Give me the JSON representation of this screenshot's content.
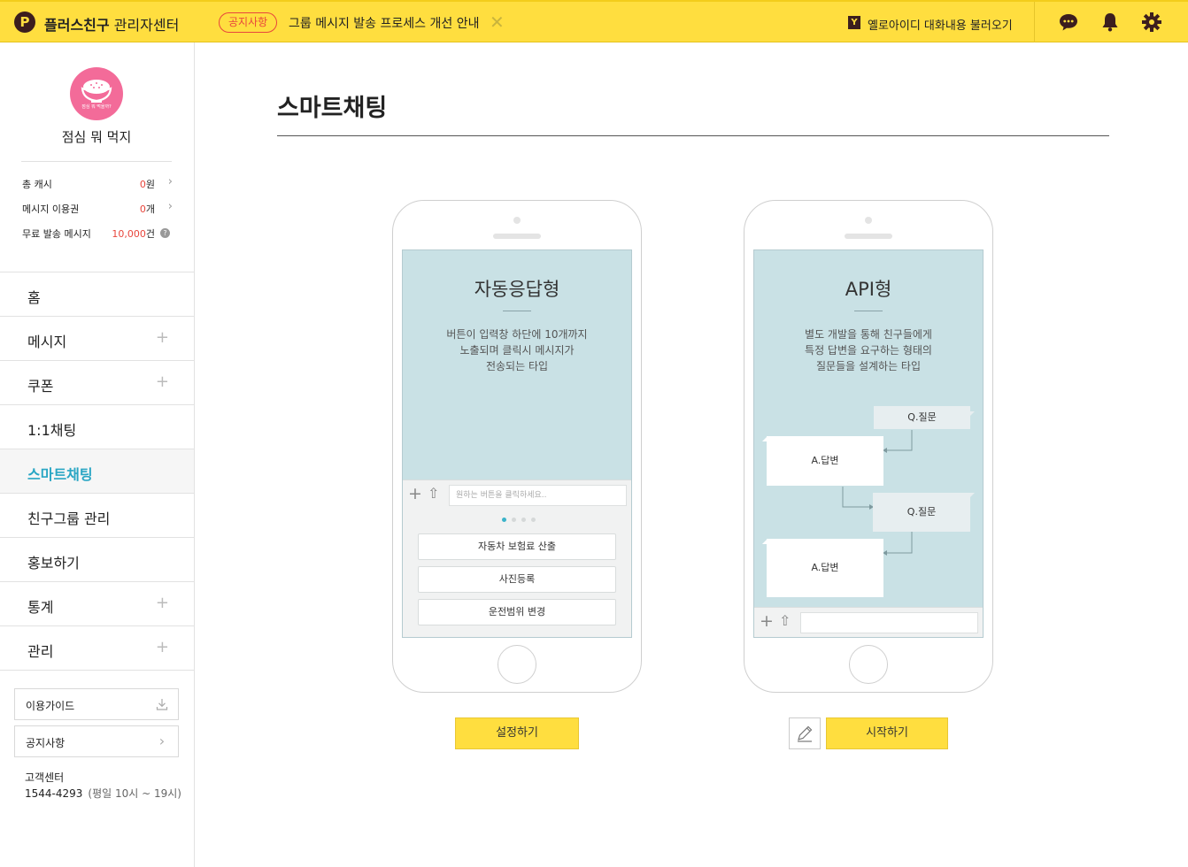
{
  "topbar": {
    "logo_glyph": "P",
    "brand_bold": "플러스친구",
    "brand_rest": " 관리자센터",
    "notice_tag": "공지사항",
    "notice_text": "그룹 메시지 발송 프로세스 개선 안내",
    "close_glyph": "✕",
    "yellowid_glyph": "Y",
    "yellowid_text": "옐로아이디 대화내용 불러오기",
    "icons": [
      "chat-bubble-icon",
      "bell-icon",
      "gear-icon"
    ]
  },
  "profile": {
    "name": "점심 뭐 먹지",
    "avatar_caption": "점심 뭐 먹을까?",
    "stats": [
      {
        "label": "총 캐시",
        "value": "0",
        "unit": "원"
      },
      {
        "label": "메시지 이용권",
        "value": "0",
        "unit": "개"
      },
      {
        "label": "무료 발송 메시지",
        "value": "10,000",
        "unit": "건"
      }
    ],
    "chevron": "›",
    "help_glyph": "?"
  },
  "nav": {
    "plus_glyph": "+",
    "items": [
      {
        "label": "홈"
      },
      {
        "label": "메시지"
      },
      {
        "label": "쿠폰"
      },
      {
        "label": "1:1채팅"
      },
      {
        "label": "스마트채팅"
      },
      {
        "label": "친구그룹 관리"
      },
      {
        "label": "홍보하기"
      },
      {
        "label": "통계"
      },
      {
        "label": "관리"
      }
    ]
  },
  "sidebar_buttons": {
    "guide": "이용가이드",
    "notice": "공지사항",
    "chevron": "›"
  },
  "customer_center": {
    "label": "고객센터",
    "phone": "1544-4293",
    "hours": "(평일 10시 ~ 19시)"
  },
  "main": {
    "title": "스마트채팅",
    "auto": {
      "title": "자동응답형",
      "desc": [
        "버튼이 입력창 하단에 10개까지",
        "노출되며 클릭시 메시지가",
        "전송되는 타입"
      ],
      "input_placeholder": "원하는 버튼을 클릭하세요..",
      "plus_glyph": "+",
      "up_glyph": "⇧",
      "buttons": [
        "자동차 보험료 산출",
        "사진등록",
        "운전범위 변경"
      ],
      "action": "설정하기"
    },
    "api": {
      "title": "API형",
      "desc": [
        "별도 개발을 통해 친구들에게",
        "특정 답변을 요구하는 형태의",
        "질문들을 설계하는 타입"
      ],
      "question": "Q.질문",
      "answer": "A.답변",
      "plus_glyph": "+",
      "up_glyph": "⇧",
      "action": "시작하기"
    }
  },
  "colors": {
    "brand_yellow": "#ffde3f",
    "accent": "#2aa6c4",
    "alert_red": "#e8463c",
    "screen_bg": "#c9e1e5"
  }
}
